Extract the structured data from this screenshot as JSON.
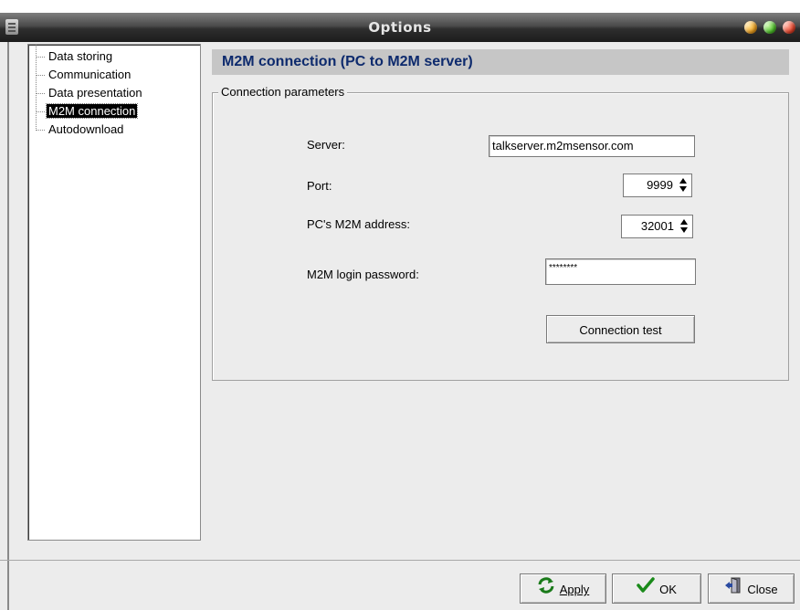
{
  "window": {
    "title": "Options"
  },
  "tree": {
    "items": [
      {
        "label": "Data storing"
      },
      {
        "label": "Communication"
      },
      {
        "label": "Data presentation"
      },
      {
        "label": "M2M connection",
        "selected": true
      },
      {
        "label": "Autodownload"
      }
    ]
  },
  "panel": {
    "header": "M2M connection (PC to M2M server)",
    "group_title": "Connection parameters",
    "server": {
      "label": "Server:",
      "value": "talkserver.m2msensor.com"
    },
    "port": {
      "label": "Port:",
      "value": "9999"
    },
    "address": {
      "label": "PC's M2M address:",
      "value": "32001"
    },
    "password": {
      "label": "M2M login password:",
      "value": "********"
    },
    "test_button": "Connection test"
  },
  "buttons": {
    "apply": "Apply",
    "ok": "OK",
    "close": "Close"
  },
  "icons": [
    "window-menu-icon",
    "minimize-icon",
    "maximize-icon",
    "close-window-icon",
    "refresh-icon",
    "checkmark-icon",
    "door-exit-icon"
  ]
}
